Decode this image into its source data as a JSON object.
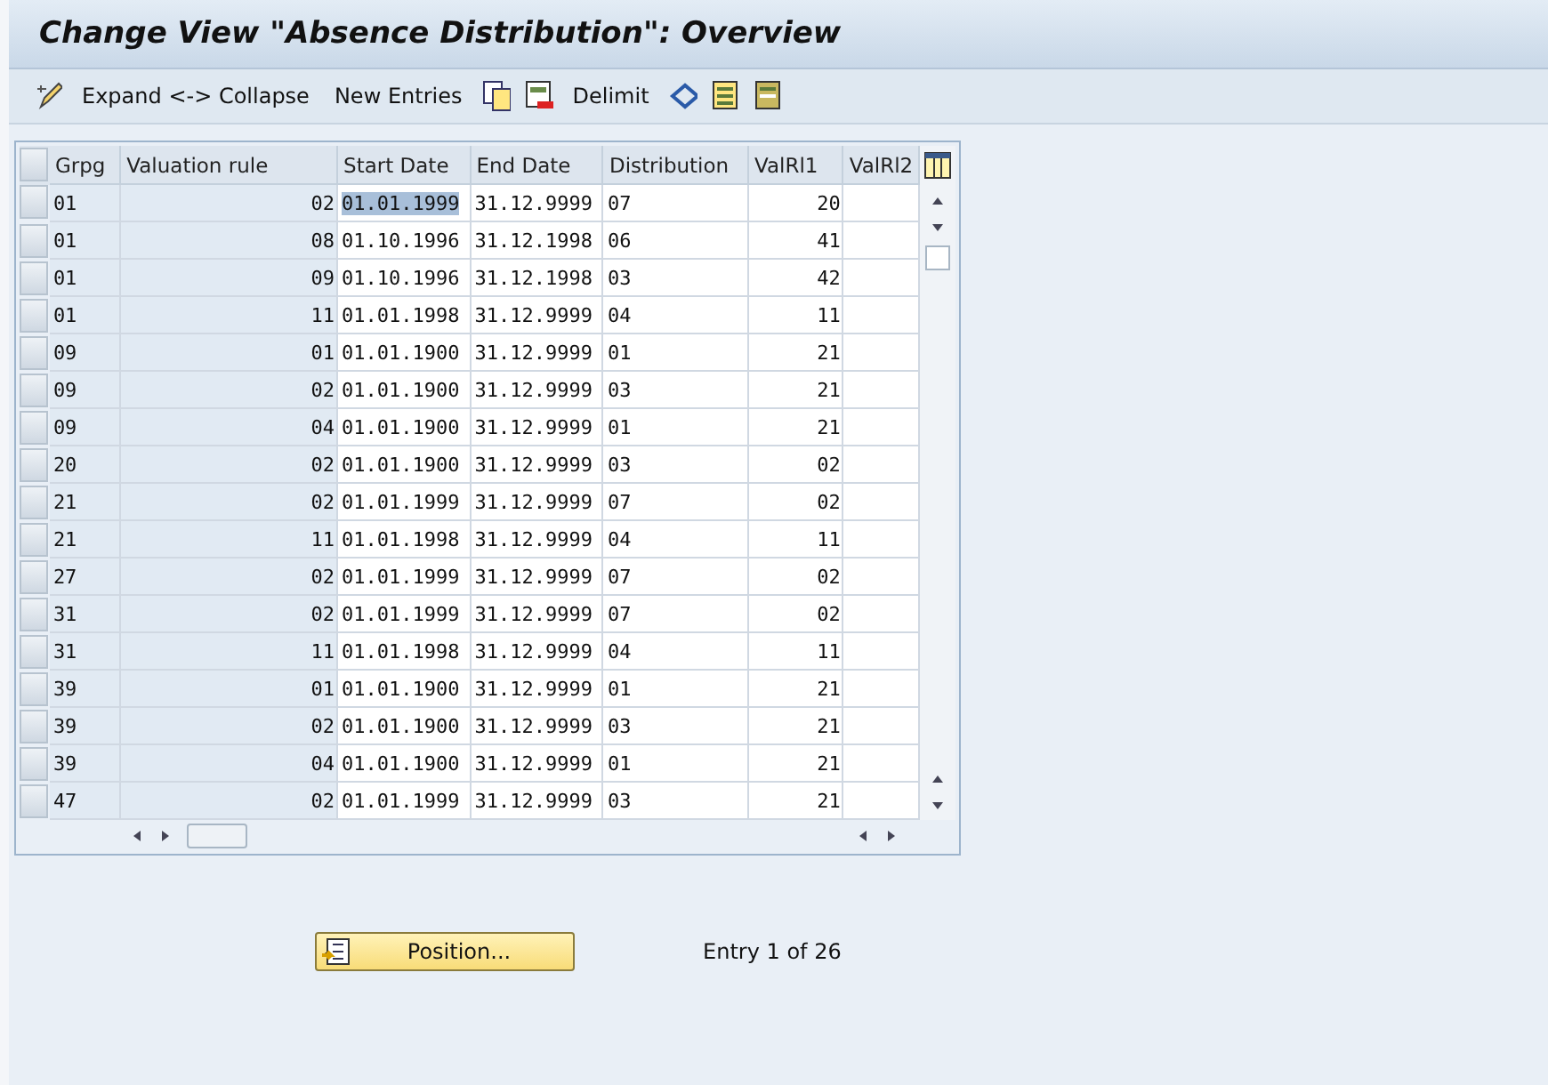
{
  "window": {
    "title": "Change View \"Absence Distribution\": Overview"
  },
  "toolbar": [
    {
      "kind": "pencil"
    },
    {
      "kind": "text",
      "label": "Expand <-> Collapse"
    },
    {
      "kind": "text",
      "label": "New Entries"
    },
    {
      "kind": "copy"
    },
    {
      "kind": "delete"
    },
    {
      "kind": "text",
      "label": "Delimit"
    },
    {
      "kind": "undo"
    },
    {
      "kind": "select"
    },
    {
      "kind": "deselect"
    }
  ],
  "table": {
    "columns": [
      "Grpg",
      "Valuation rule",
      "Start Date",
      "End Date",
      "Distribution",
      "ValRl1",
      "ValRl2"
    ],
    "rows": [
      {
        "cells": [
          "01",
          "02",
          "01.01.1999",
          "31.12.9999",
          "07",
          "20",
          ""
        ],
        "focused": true
      },
      {
        "cells": [
          "01",
          "08",
          "01.10.1996",
          "31.12.1998",
          "06",
          "41",
          ""
        ],
        "focused": false
      },
      {
        "cells": [
          "01",
          "09",
          "01.10.1996",
          "31.12.1998",
          "03",
          "42",
          ""
        ],
        "focused": false
      },
      {
        "cells": [
          "01",
          "11",
          "01.01.1998",
          "31.12.9999",
          "04",
          "11",
          ""
        ],
        "focused": false
      },
      {
        "cells": [
          "09",
          "01",
          "01.01.1900",
          "31.12.9999",
          "01",
          "21",
          ""
        ],
        "focused": false
      },
      {
        "cells": [
          "09",
          "02",
          "01.01.1900",
          "31.12.9999",
          "03",
          "21",
          ""
        ],
        "focused": false
      },
      {
        "cells": [
          "09",
          "04",
          "01.01.1900",
          "31.12.9999",
          "01",
          "21",
          ""
        ],
        "focused": false
      },
      {
        "cells": [
          "20",
          "02",
          "01.01.1900",
          "31.12.9999",
          "03",
          "02",
          ""
        ],
        "focused": false
      },
      {
        "cells": [
          "21",
          "02",
          "01.01.1999",
          "31.12.9999",
          "07",
          "02",
          ""
        ],
        "focused": false
      },
      {
        "cells": [
          "21",
          "11",
          "01.01.1998",
          "31.12.9999",
          "04",
          "11",
          ""
        ],
        "focused": false
      },
      {
        "cells": [
          "27",
          "02",
          "01.01.1999",
          "31.12.9999",
          "07",
          "02",
          ""
        ],
        "focused": false
      },
      {
        "cells": [
          "31",
          "02",
          "01.01.1999",
          "31.12.9999",
          "07",
          "02",
          ""
        ],
        "focused": false
      },
      {
        "cells": [
          "31",
          "11",
          "01.01.1998",
          "31.12.9999",
          "04",
          "11",
          ""
        ],
        "focused": false
      },
      {
        "cells": [
          "39",
          "01",
          "01.01.1900",
          "31.12.9999",
          "01",
          "21",
          ""
        ],
        "focused": false
      },
      {
        "cells": [
          "39",
          "02",
          "01.01.1900",
          "31.12.9999",
          "03",
          "21",
          ""
        ],
        "focused": false
      },
      {
        "cells": [
          "39",
          "04",
          "01.01.1900",
          "31.12.9999",
          "01",
          "21",
          ""
        ],
        "focused": false
      },
      {
        "cells": [
          "47",
          "02",
          "01.01.1999",
          "31.12.9999",
          "03",
          "21",
          ""
        ],
        "focused": false
      }
    ]
  },
  "position_button": {
    "label": "Position..."
  },
  "entry_info": "Entry 1 of 26"
}
